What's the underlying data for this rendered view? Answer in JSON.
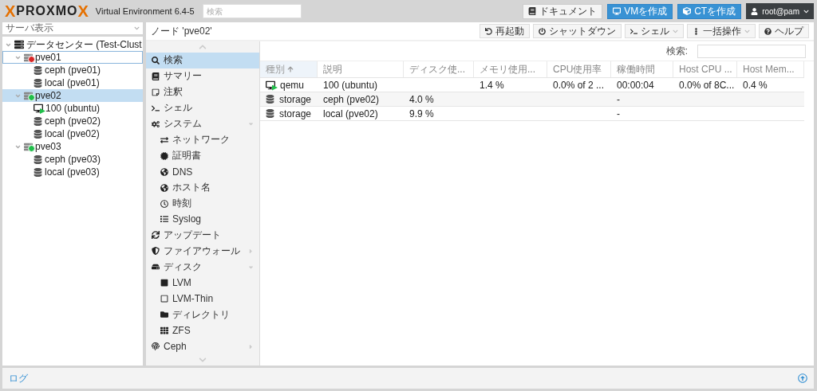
{
  "header": {
    "logo": {
      "x1": "X",
      "text": "PROXMO",
      "x2": "X"
    },
    "version": "Virtual Environment 6.4-5",
    "search": {
      "placeholder": "検索"
    },
    "buttons": [
      {
        "label": "ドキュメント",
        "kind": "doc"
      },
      {
        "label": "VMを作成",
        "kind": "vm"
      },
      {
        "label": "CTを作成",
        "kind": "ct"
      }
    ],
    "user": "root@pam"
  },
  "sidebar": {
    "view": "サーバ表示",
    "tree": [
      {
        "label": "データセンター (Test-Clust",
        "kind": "datacenter",
        "expanded": true,
        "selected": false,
        "focused": false,
        "children": [
          {
            "label": "pve01",
            "kind": "node",
            "online": false,
            "expanded": true,
            "selected": false,
            "focused": true,
            "children": [
              {
                "label": "ceph (pve01)",
                "kind": "storage",
                "selected": false,
                "focused": false
              },
              {
                "label": "local (pve01)",
                "kind": "storage",
                "selected": false,
                "focused": false
              }
            ]
          },
          {
            "label": "pve02",
            "kind": "node",
            "online": true,
            "expanded": true,
            "selected": true,
            "focused": false,
            "children": [
              {
                "label": "100 (ubuntu)",
                "kind": "vm",
                "selected": false,
                "focused": false
              },
              {
                "label": "ceph (pve02)",
                "kind": "storage",
                "selected": false,
                "focused": false
              },
              {
                "label": "local (pve02)",
                "kind": "storage",
                "selected": false,
                "focused": false
              }
            ]
          },
          {
            "label": "pve03",
            "kind": "node",
            "online": true,
            "expanded": true,
            "selected": false,
            "focused": false,
            "children": [
              {
                "label": "ceph (pve03)",
                "kind": "storage",
                "selected": false,
                "focused": false
              },
              {
                "label": "local (pve03)",
                "kind": "storage",
                "selected": false,
                "focused": false
              }
            ]
          }
        ]
      }
    ]
  },
  "content": {
    "title": "ノード 'pve02'",
    "toolbar": [
      {
        "label": "再起動",
        "kind": "restart",
        "dropdown": false
      },
      {
        "label": "シャットダウン",
        "kind": "shutdown",
        "dropdown": false
      },
      {
        "label": "シェル",
        "kind": "shell",
        "dropdown": true
      },
      {
        "label": "一括操作",
        "kind": "bulk",
        "dropdown": true
      },
      {
        "label": "ヘルプ",
        "kind": "help",
        "dropdown": false
      }
    ],
    "nav": [
      {
        "label": "検索",
        "kind": "search",
        "selected": true
      },
      {
        "label": "サマリー",
        "kind": "summary",
        "selected": false
      },
      {
        "label": "注釈",
        "kind": "notes",
        "selected": false
      },
      {
        "label": "シェル",
        "kind": "shell",
        "selected": false
      },
      {
        "label": "システム",
        "kind": "system",
        "selected": false,
        "expanded": true,
        "children": [
          {
            "label": "ネットワーク",
            "kind": "network",
            "selected": false
          },
          {
            "label": "証明書",
            "kind": "cert",
            "selected": false
          },
          {
            "label": "DNS",
            "kind": "globe",
            "selected": false
          },
          {
            "label": "ホスト名",
            "kind": "globe",
            "selected": false
          },
          {
            "label": "時刻",
            "kind": "clock",
            "selected": false
          },
          {
            "label": "Syslog",
            "kind": "list",
            "selected": false
          }
        ]
      },
      {
        "label": "アップデート",
        "kind": "update",
        "selected": false
      },
      {
        "label": "ファイアウォール",
        "kind": "firewall",
        "selected": false,
        "expanded": false
      },
      {
        "label": "ディスク",
        "kind": "disk",
        "selected": false,
        "expanded": true,
        "children": [
          {
            "label": "LVM",
            "kind": "lvm",
            "selected": false
          },
          {
            "label": "LVM-Thin",
            "kind": "lvmthin",
            "selected": false
          },
          {
            "label": "ディレクトリ",
            "kind": "folder",
            "selected": false
          },
          {
            "label": "ZFS",
            "kind": "zfs",
            "selected": false
          }
        ]
      },
      {
        "label": "Ceph",
        "kind": "ceph",
        "selected": false,
        "expanded": false
      }
    ],
    "grid": {
      "search_label": "検索:",
      "columns": [
        {
          "label": "種別",
          "sorted": true
        },
        {
          "label": "説明",
          "sorted": false
        },
        {
          "label": "ディスク使...",
          "sorted": false
        },
        {
          "label": "メモリ使用...",
          "sorted": false
        },
        {
          "label": "CPU使用率",
          "sorted": false
        },
        {
          "label": "稼働時間",
          "sorted": false
        },
        {
          "label": "Host CPU ...",
          "sorted": false
        },
        {
          "label": "Host Mem...",
          "sorted": false
        }
      ],
      "rows": [
        {
          "kind": "vm",
          "cells": [
            "qemu",
            "100 (ubuntu)",
            "",
            "1.4 %",
            "0.0% of 2 ...",
            "00:00:04",
            "0.0% of 8C...",
            "0.4 %"
          ]
        },
        {
          "kind": "storage",
          "cells": [
            "storage",
            "ceph (pve02)",
            "4.0 %",
            "",
            "",
            "-",
            "",
            ""
          ]
        },
        {
          "kind": "storage",
          "cells": [
            "storage",
            "local (pve02)",
            "9.9 %",
            "",
            "",
            "-",
            "",
            ""
          ]
        }
      ]
    }
  },
  "log": {
    "label": "ログ"
  }
}
